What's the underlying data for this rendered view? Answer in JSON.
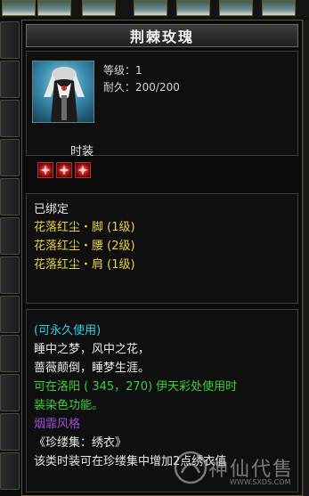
{
  "tooltip": {
    "title": "荆棘玫瑰",
    "level": "等级：1",
    "durability": "耐久：200/200",
    "category": "时装",
    "slots": [
      "gem-slot",
      "gem-slot",
      "gem-slot"
    ],
    "bound": "已绑定",
    "set_items": [
      "花落红尘・脚 (1级)",
      "花落红尘・腰 (2级)",
      "花落红尘・肩 (1级)"
    ],
    "usage": "(可永久使用)",
    "poem_1": "睡中之梦，风中之花，",
    "poem_2": "蔷薇颠倒，睡梦生涯。",
    "dye_1": "可在洛阳 ( 345，270) 伊天彩处使用时",
    "dye_2": "装染色功能。",
    "style": "烟霏风格",
    "collection": "《珍缕集：绣衣》",
    "collection_note": "该类时装可在珍缕集中增加2点绣衣值"
  },
  "watermark": {
    "text": "神仙代售",
    "url": "WWW.SXDS.COM"
  },
  "colors": {
    "set_item": "#e6d24a",
    "usage": "#2fd0e8",
    "dye": "#3bd23b",
    "style": "#a04bd6",
    "gem": "#cc2222"
  }
}
